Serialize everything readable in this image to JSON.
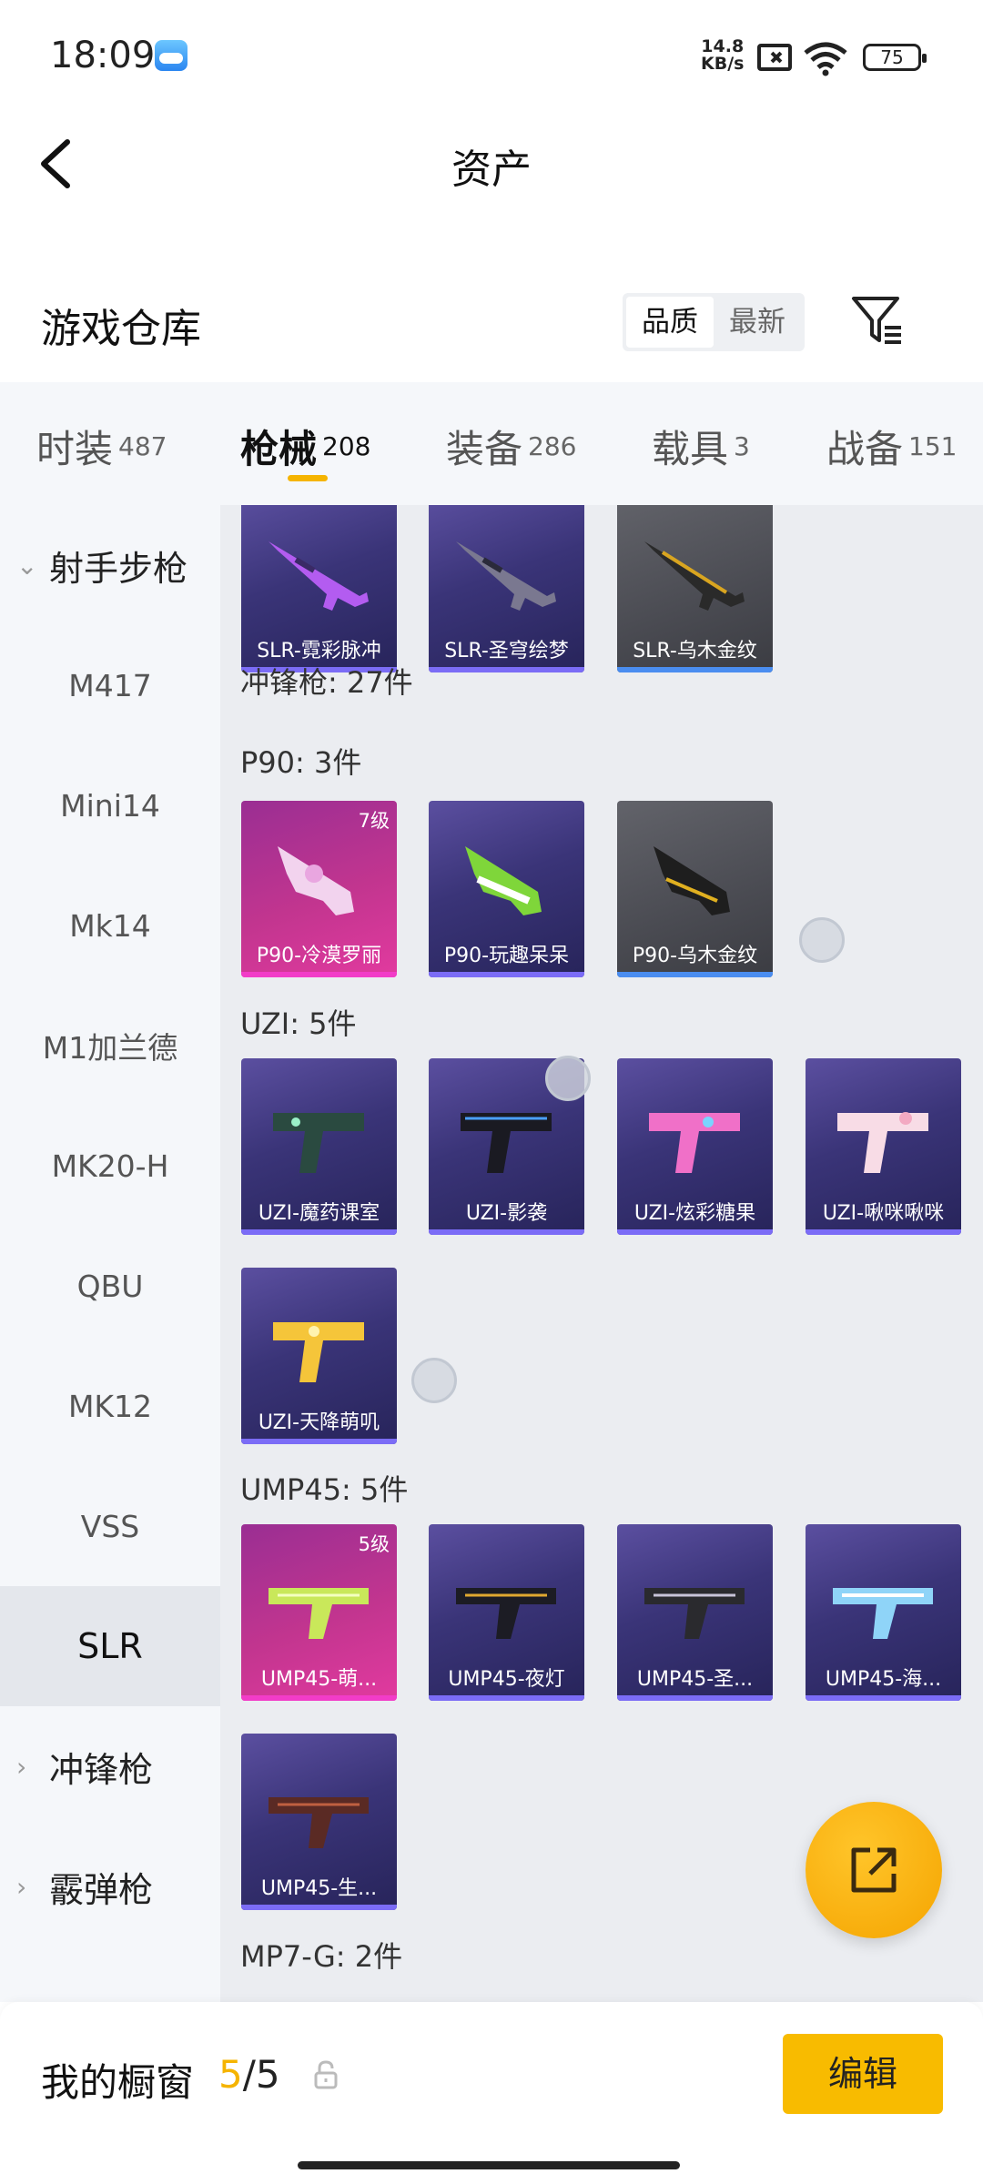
{
  "status_bar": {
    "time": "18:09",
    "net_speed_value": "14.8",
    "net_speed_unit": "KB/s",
    "battery": "75"
  },
  "header": {
    "title": "资产"
  },
  "warehouse": {
    "title": "游戏仓库",
    "sort_options": [
      "品质",
      "最新"
    ],
    "sort_selected": "品质"
  },
  "tabs": [
    {
      "label": "时装",
      "count": "487"
    },
    {
      "label": "枪械",
      "count": "208",
      "active": true
    },
    {
      "label": "装备",
      "count": "286"
    },
    {
      "label": "载具",
      "count": "3"
    },
    {
      "label": "战备",
      "count": "151"
    }
  ],
  "sidebar": {
    "group_expanded": "射手步枪",
    "items": [
      "M417",
      "Mini14",
      "Mk14",
      "M1加兰德",
      "MK20-H",
      "QBU",
      "MK12",
      "VSS",
      "SLR"
    ],
    "selected": "SLR",
    "groups_collapsed": [
      "冲锋枪",
      "霰弹枪"
    ]
  },
  "content": {
    "slr_cards": [
      {
        "name": "SLR-霓彩脉冲",
        "rarity": "purple"
      },
      {
        "name": "SLR-圣穹绘梦",
        "rarity": "purple"
      },
      {
        "name": "SLR-乌木金纹",
        "rarity": "gray"
      }
    ],
    "smg_header": "冲锋枪: 27件",
    "sections": [
      {
        "title": "P90: 3件",
        "cards": [
          {
            "name": "P90-冷漠罗丽",
            "rarity": "pink",
            "level": "7级"
          },
          {
            "name": "P90-玩趣呆呆",
            "rarity": "purple"
          },
          {
            "name": "P90-乌木金纹",
            "rarity": "gray"
          }
        ]
      },
      {
        "title": "UZI: 5件",
        "cards": [
          {
            "name": "UZI-魔药课室",
            "rarity": "purple"
          },
          {
            "name": "UZI-影袭",
            "rarity": "purple"
          },
          {
            "name": "UZI-炫彩糖果",
            "rarity": "purple"
          },
          {
            "name": "UZI-啾咪啾咪",
            "rarity": "purple"
          },
          {
            "name": "UZI-天降萌叽",
            "rarity": "purple"
          }
        ]
      },
      {
        "title": "UMP45: 5件",
        "cards": [
          {
            "name": "UMP45-萌...",
            "rarity": "pink",
            "level": "5级"
          },
          {
            "name": "UMP45-夜灯",
            "rarity": "purple"
          },
          {
            "name": "UMP45-圣...",
            "rarity": "purple"
          },
          {
            "name": "UMP45-海...",
            "rarity": "purple"
          },
          {
            "name": "UMP45-生...",
            "rarity": "purple"
          }
        ]
      },
      {
        "title": "MP7-G: 2件",
        "cards": []
      }
    ]
  },
  "bottom_bar": {
    "label": "我的橱窗",
    "current": "5",
    "separator": "/",
    "total": "5",
    "edit_label": "编辑"
  },
  "colors": {
    "accent": "#f5b400",
    "purple_card": "#3a3478",
    "pink_card": "#c2358f",
    "gray_card": "#4a4b52"
  },
  "icons": [
    "back-arrow-icon",
    "filter-icon",
    "lock-icon",
    "share-icon",
    "chevron-down-icon",
    "chevron-right-icon"
  ]
}
